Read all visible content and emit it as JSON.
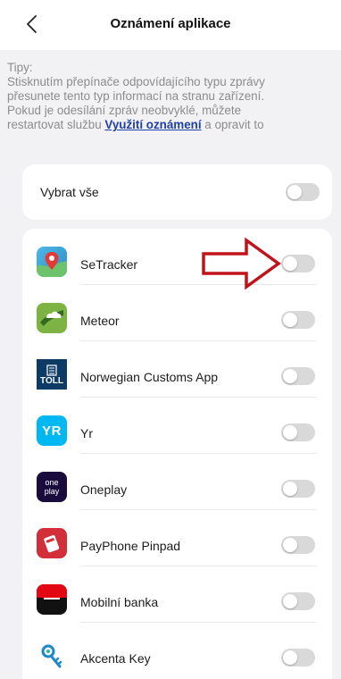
{
  "header": {
    "title": "Oznámení aplikace",
    "back_icon": "chevron-left-icon"
  },
  "tips": {
    "lines": [
      "Tipy:",
      " Stisknutím přepínače odpovídajícího typu zprávy",
      "přesunete tento typ informací na stranu zařízení.",
      "Pokud je odesílání zpráv neobvyklé, můžete"
    ],
    "last_prefix": "restartovat službu ",
    "link_text": "Využití oznámení",
    "last_suffix": " a opravit to"
  },
  "select_all": {
    "label": "Vybrat vše",
    "enabled": false
  },
  "apps": [
    {
      "name": "SeTracker",
      "icon": "setracker-map-pin-icon",
      "enabled": false
    },
    {
      "name": "Meteor",
      "icon": "meteor-cloud-icon",
      "enabled": false
    },
    {
      "name": "Norwegian Customs App",
      "icon": "toll-icon",
      "icon_text": "TOLL",
      "enabled": false
    },
    {
      "name": "Yr",
      "icon": "yr-icon",
      "icon_text": "YR",
      "enabled": false
    },
    {
      "name": "Oneplay",
      "icon": "oneplay-icon",
      "icon_text_top": "one",
      "icon_text_bottom": "play",
      "enabled": false
    },
    {
      "name": "PayPhone Pinpad",
      "icon": "payphone-card-icon",
      "enabled": false
    },
    {
      "name": "Mobilní banka",
      "icon": "mobilni-banka-icon",
      "enabled": false
    },
    {
      "name": "Akcenta Key",
      "icon": "akcenta-key-icon",
      "enabled": false
    }
  ],
  "annotation": {
    "arrow_icon": "red-outline-arrow-right-icon",
    "arrow_color": "#c0141c"
  },
  "colors": {
    "background": "#f2f2f4",
    "card": "#ffffff",
    "tips_text": "#8c8c8c",
    "link": "#1f3fa8",
    "toggle_off": "#d9d9d9"
  }
}
